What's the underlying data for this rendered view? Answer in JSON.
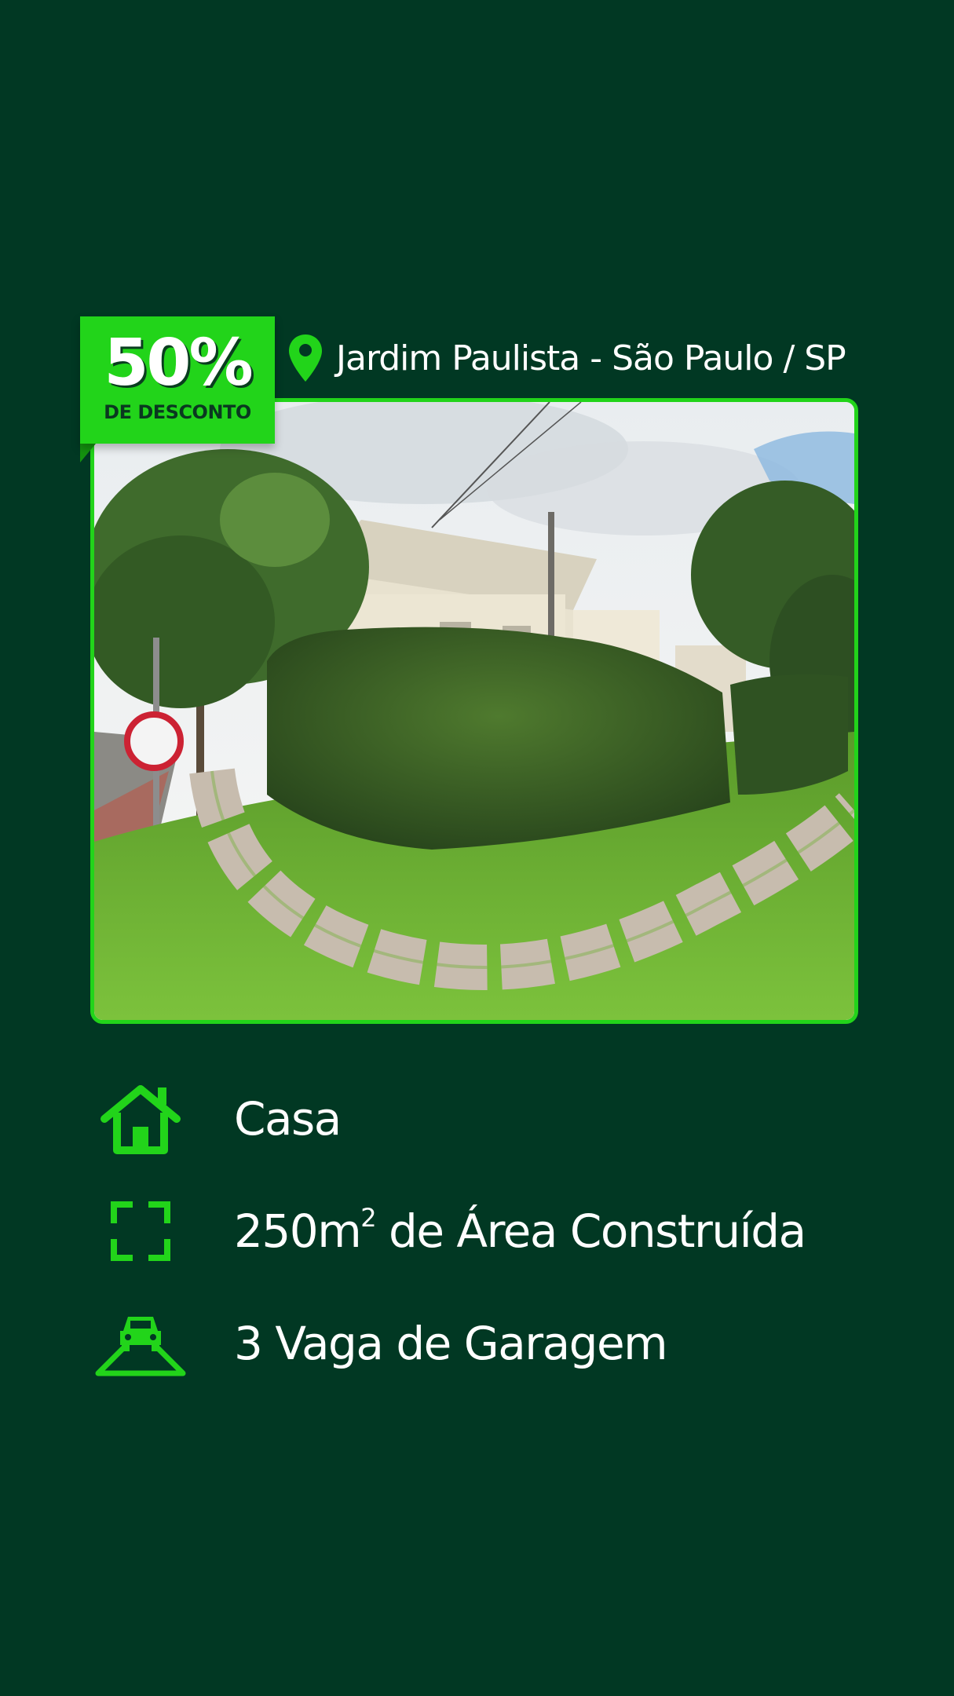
{
  "badge": {
    "percent": "50%",
    "label": "DE DESCONTO"
  },
  "location": {
    "icon": "map-pin-icon",
    "text": "Jardim Paulista - São Paulo / SP"
  },
  "photo": {
    "subject": "house-with-hedge-and-stone-path"
  },
  "features": {
    "type": {
      "icon": "house-icon",
      "text": "Casa"
    },
    "area": {
      "icon": "area-frame-icon",
      "value": "250m",
      "superscript": "2",
      "suffix": " de Área Construída"
    },
    "garage": {
      "icon": "car-garage-icon",
      "text": "3 Vaga de Garagem"
    }
  },
  "colors": {
    "background": "#013823",
    "accent": "#22d41a",
    "text": "#ffffff"
  }
}
